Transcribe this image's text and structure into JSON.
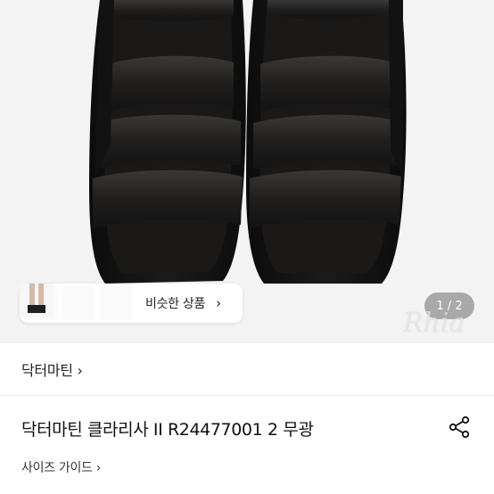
{
  "similar": {
    "label": "비슷한 상품",
    "chevron": "›",
    "thumbnails": [
      "sandal-thumb-icon",
      "shoe-thumb-icon",
      "legs-sandal-thumb-icon"
    ]
  },
  "image_counter": "1 / 2",
  "watermark": "Rhia",
  "brand": {
    "label": "닥터마틴 ›"
  },
  "product": {
    "title": "닥터마틴 클라리사 II R24477001 2 무광",
    "share_icon": "share-icon"
  },
  "size_guide": {
    "label": "사이즈 가이드 ›"
  }
}
